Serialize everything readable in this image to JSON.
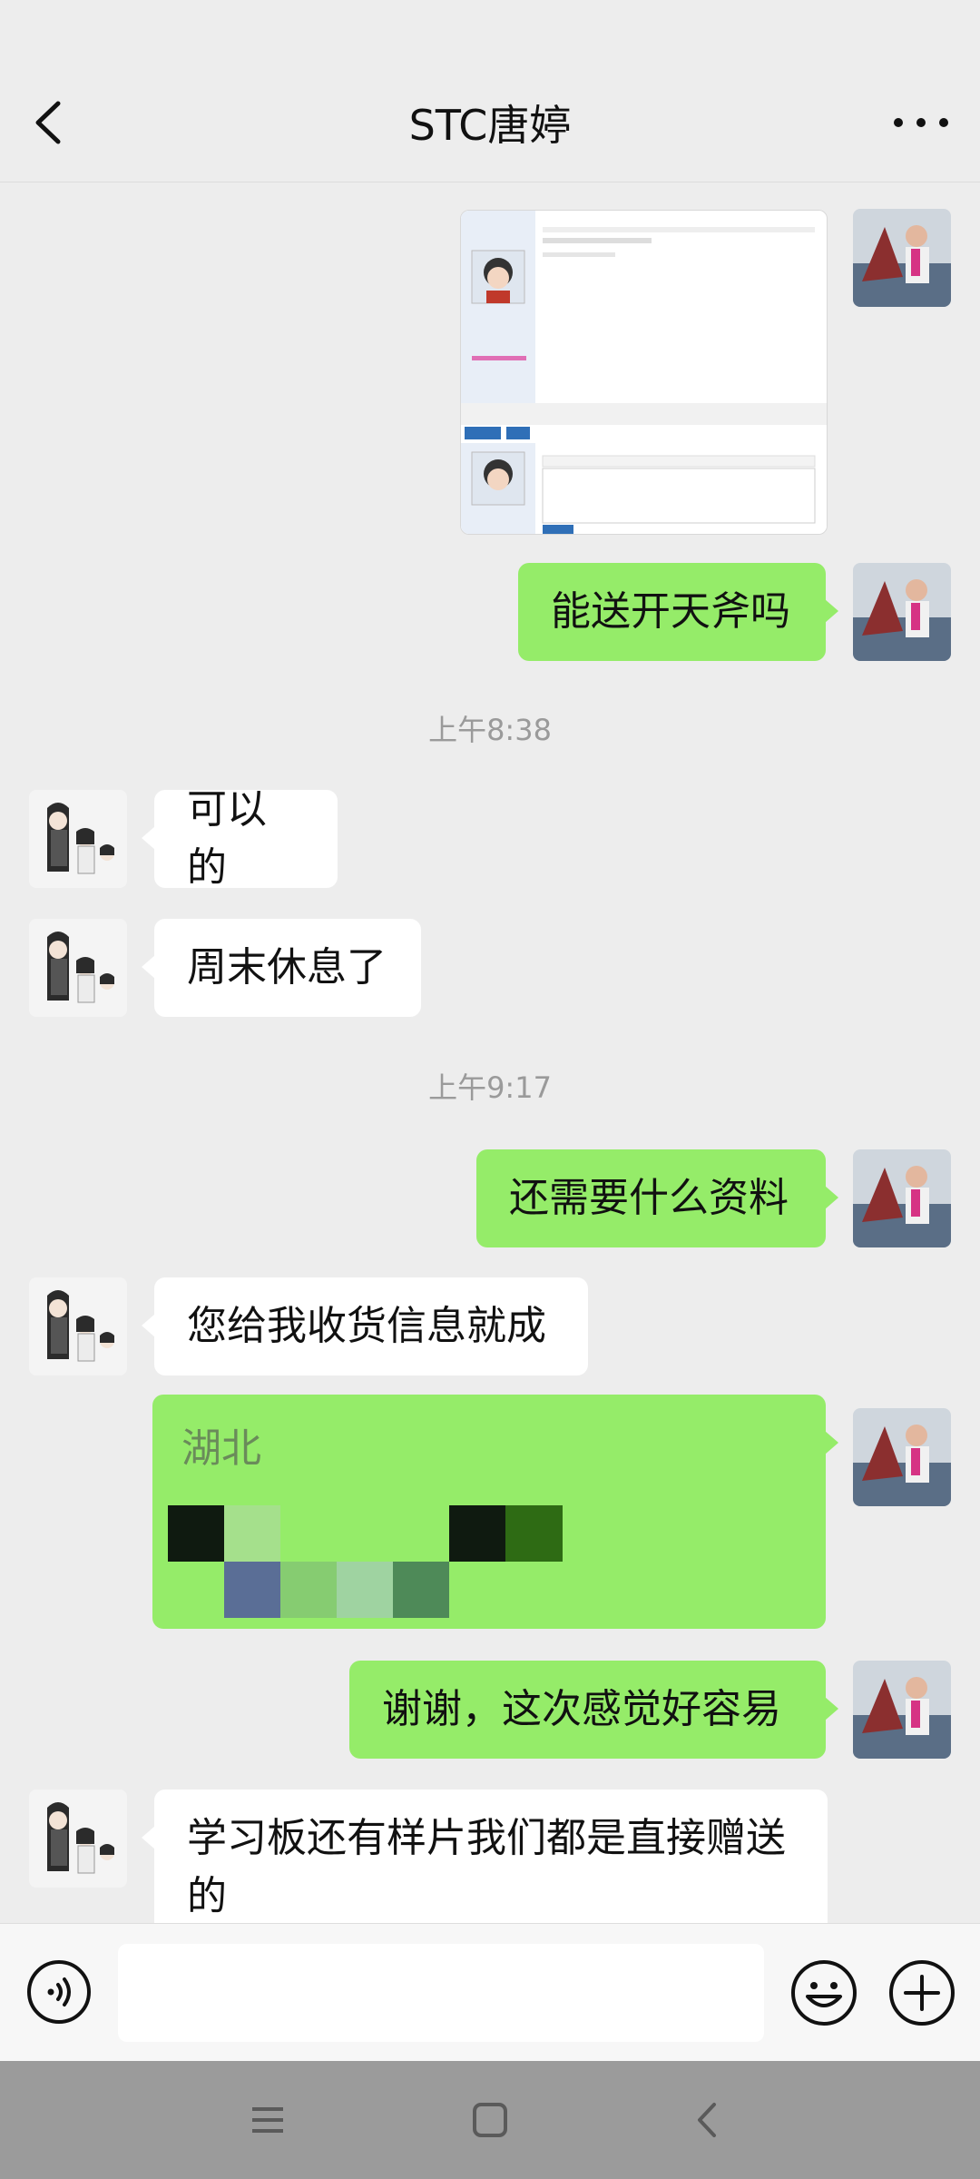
{
  "header": {
    "title": "STC唐婷",
    "back_icon": "chevron-left-icon",
    "more_icon": "more-horizontal-icon"
  },
  "messages": {
    "m1_image": "forum-screenshot-image",
    "m2_text": "能送开天斧吗",
    "time1": "上午8:38",
    "m3_text": "可以的",
    "m4_text": "周末休息了",
    "time2": "上午9:17",
    "m5_text": "还需要什么资料",
    "m6_text": "您给我收货信息就成",
    "m7_text": "湖北",
    "m8_text": "谢谢，这次感觉好容易",
    "m9_text": "学习板还有样片我们都是直接赠送的"
  },
  "inputbar": {
    "voice_icon": "voice-icon",
    "emoji_icon": "emoji-icon",
    "plus_icon": "plus-icon"
  },
  "navbar": {
    "menu_icon": "menu-icon",
    "home_icon": "home-icon",
    "back_icon": "back-icon"
  },
  "colors": {
    "outgoing_bubble": "#95EC69",
    "incoming_bubble": "#FFFFFF",
    "background": "#EDEDED",
    "navbar": "#9B9B9B"
  }
}
